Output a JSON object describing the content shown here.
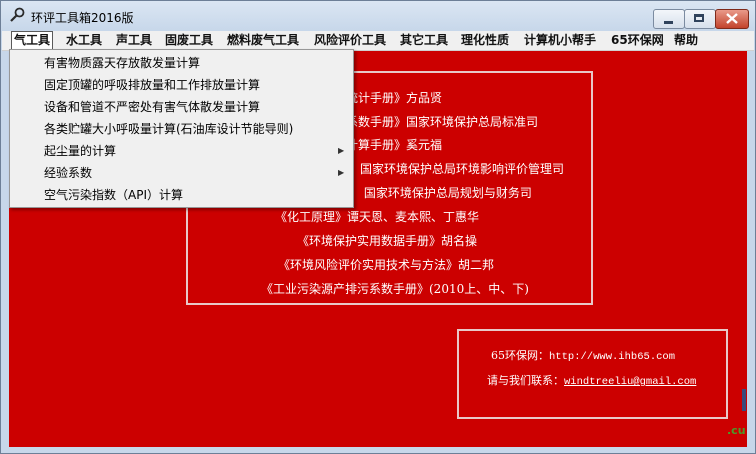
{
  "window": {
    "title": "环评工具箱2016版",
    "close_color": "#c2432c"
  },
  "menubar": {
    "items": [
      {
        "label": "气工具"
      },
      {
        "label": "水工具"
      },
      {
        "label": "声工具"
      },
      {
        "label": "固废工具"
      },
      {
        "label": "燃料废气工具"
      },
      {
        "label": "风险评价工具"
      },
      {
        "label": "其它工具"
      },
      {
        "label": "理化性质"
      },
      {
        "label": "计算机小帮手"
      },
      {
        "label": "65环保网"
      },
      {
        "label": "帮助"
      }
    ]
  },
  "dropdown": {
    "items": [
      {
        "label": "有害物质露天存放散发量计算",
        "submenu": false
      },
      {
        "label": "固定顶罐的呼吸排放量和工作排放量计算",
        "submenu": false
      },
      {
        "label": "设备和管道不严密处有害气体散发量计算",
        "submenu": false
      },
      {
        "label": "各类贮罐大小呼吸量计算(石油库设计节能导则)",
        "submenu": false
      },
      {
        "label": "起尘量的计算",
        "submenu": true
      },
      {
        "label": "经验系数",
        "submenu": true
      },
      {
        "label": "空气污染指数（API）计算",
        "submenu": false
      }
    ],
    "arrow_glyph": "▶"
  },
  "references": {
    "lines": [
      "统计手册》方品贤",
      "系数手册》国家环境保护总局标准司",
      "计算手册》奚元福",
      "》国家环境保护总局环境影响评价管理司",
      "》 国家环境保护总局规划与财务司",
      "《化工原理》谭天恩、麦本熙、丁惠华",
      "《环境保护实用数据手册》胡名操",
      "《环境风险评价实用技术与方法》胡二邦",
      "《工业污染源产排污系数手册》(2010上、中、下)"
    ]
  },
  "contact": {
    "site_label": "65环保网：",
    "site_url": "http://www.ihb65.com",
    "email_label": "请与我们联系：",
    "email": "windtreeliu@gmail.com"
  },
  "watermark_text": ".cu",
  "colors": {
    "client_bg": "#cc0000",
    "menubar_bg": "#f0f0f0",
    "accent_text": "#ffffff"
  }
}
